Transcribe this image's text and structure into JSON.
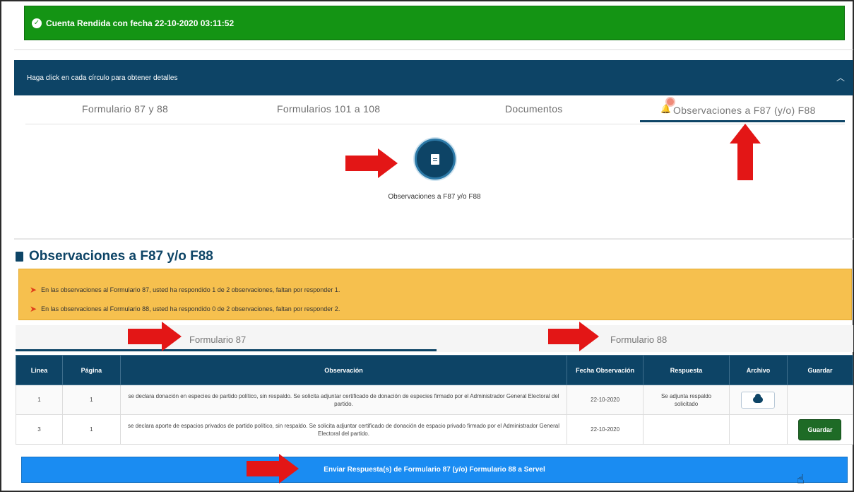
{
  "banner": {
    "success_text": "Cuenta Rendida con fecha 22-10-2020 03:11:52",
    "color": "#149414"
  },
  "panel": {
    "header_text": "Haga click en cada círculo para obtener detalles"
  },
  "top_tabs": [
    {
      "label": "Formulario 87 y 88"
    },
    {
      "label": "Formularios 101 a 108"
    },
    {
      "label": "Documentos"
    },
    {
      "label": "Observaciones a F87 (y/o) F88",
      "active": true
    }
  ],
  "circle": {
    "caption": "Observaciones a F87 y/o F88"
  },
  "section": {
    "title": "Observaciones a F87 y/o F88"
  },
  "warnings": [
    "En las observaciones al Formulario 87, usted ha respondido 1 de 2 observaciones, faltan por responder 1.",
    "En las observaciones al Formulario 88, usted ha respondido 0 de 2 observaciones, faltan por responder 2."
  ],
  "sub_tabs": [
    {
      "label": "Formulario 87",
      "active": true
    },
    {
      "label": "Formulario 88"
    }
  ],
  "table": {
    "headers": [
      "Linea",
      "Página",
      "Observación",
      "Fecha Observación",
      "Respuesta",
      "Archivo",
      "Guardar"
    ],
    "rows": [
      {
        "linea": "1",
        "pagina": "1",
        "observacion": "se declara donación en especies de partido político, sin respaldo. Se solicita adjuntar certificado de donación de especies firmado por el Administrador General Electoral del partido.",
        "fecha": "22-10-2020",
        "respuesta": "Se adjunta respaldo solicitado",
        "archivo_icon": "cloud-upload-icon",
        "guardar": ""
      },
      {
        "linea": "3",
        "pagina": "1",
        "observacion": "se declara aporte de espacios privados de partido político, sin respaldo. Se solicita adjuntar certificado de donación de espacio privado firmado por el Administrador General Electoral del partido.",
        "fecha": "22-10-2020",
        "respuesta": "",
        "archivo_icon": "",
        "guardar": "Guardar"
      }
    ]
  },
  "submit": {
    "label": "Enviar Respuesta(s) de Formulario 87 (y/o) Formulario 88 a Servel"
  },
  "colors": {
    "navy": "#0d4466",
    "warning": "#f6c04e",
    "submit_blue": "#1a8cf2",
    "arrow_red": "#e31616"
  }
}
